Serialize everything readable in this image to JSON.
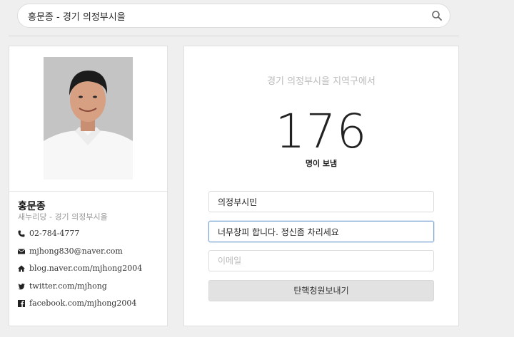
{
  "search": {
    "value": "홍문종 - 경기 의정부시을",
    "icon": "search-icon"
  },
  "profile": {
    "name": "홍문종",
    "subtitle": "새누리당 - 경기 의정부시을",
    "contacts": [
      {
        "icon": "phone-icon",
        "text": "02-784-4777"
      },
      {
        "icon": "envelope-icon",
        "text": "mjhong830@naver.com"
      },
      {
        "icon": "home-icon",
        "text": "blog.naver.com/mjhong2004"
      },
      {
        "icon": "twitter-icon",
        "text": "twitter.com/mjhong"
      },
      {
        "icon": "facebook-icon",
        "text": "facebook.com/mjhong2004"
      }
    ]
  },
  "petition": {
    "region_text": "경기 의정부시을 지역구에서",
    "count": "176",
    "count_label": "명이 보냄",
    "name_value": "의정부시민",
    "message_value": "너무창피 합니다. 정신좀 차리세요",
    "email_placeholder": "이메일",
    "submit_label": "탄핵청원보내기"
  },
  "colors": {
    "background": "#efefef",
    "card": "#ffffff",
    "focus_border": "#7fa7d6",
    "button": "#e2e2e2"
  }
}
